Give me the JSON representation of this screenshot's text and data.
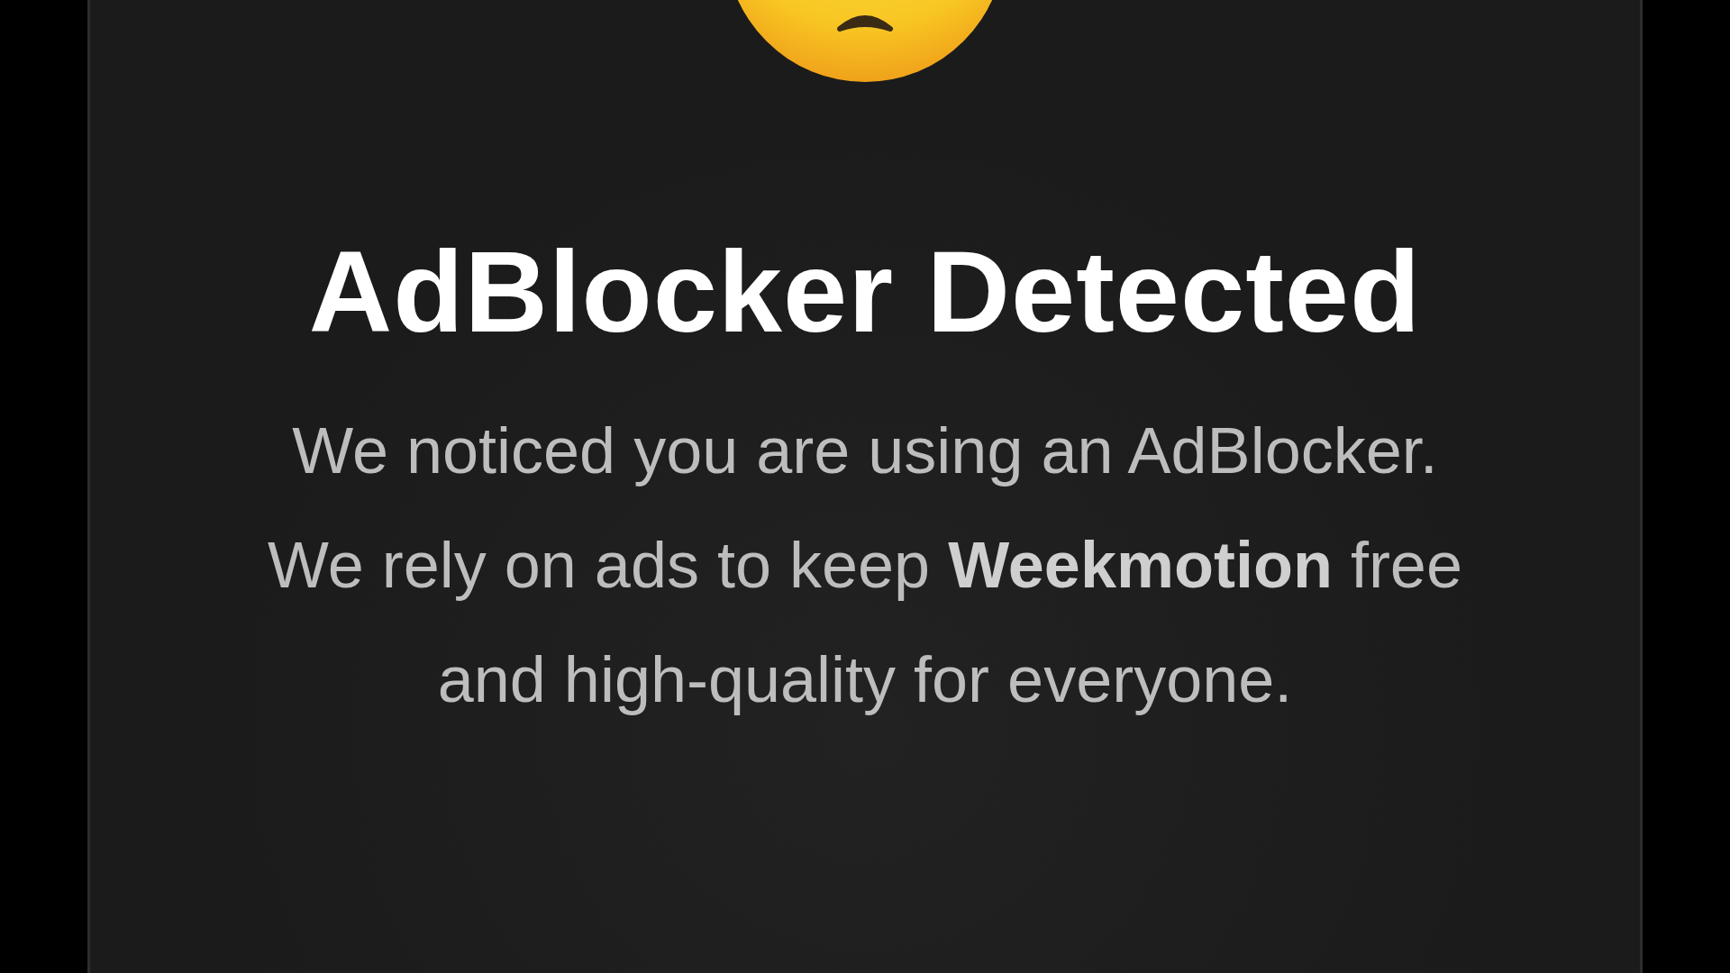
{
  "dialog": {
    "title": "AdBlocker Detected",
    "message": "We noticed you are using an AdBlocker. We rely on ads to keep **Weekmotion** free and high-quality for everyone."
  }
}
